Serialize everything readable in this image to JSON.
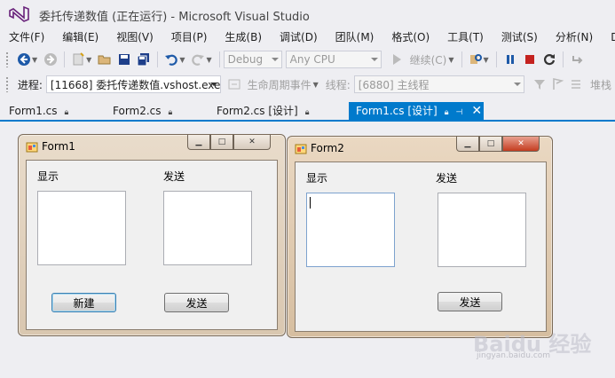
{
  "window": {
    "title": "委托传递数值 (正在运行) - Microsoft Visual Studio"
  },
  "menu": [
    "文件(F)",
    "编辑(E)",
    "视图(V)",
    "项目(P)",
    "生成(B)",
    "调试(D)",
    "团队(M)",
    "格式(O)",
    "工具(T)",
    "测试(S)",
    "分析(N)",
    "Dev"
  ],
  "toolbar": {
    "config": "Debug",
    "platform": "Any CPU",
    "continue_label": "继续(C)"
  },
  "debug_location": {
    "process_label": "进程:",
    "process_value": "[11668] 委托传递数值.vshost.exe",
    "lifecycle_label": "生命周期事件",
    "thread_label": "线程:",
    "thread_value": "[6880] 主线程",
    "stack_label": "堆栈"
  },
  "tabs": [
    {
      "label": "Form1.cs",
      "active": false
    },
    {
      "label": "Form2.cs",
      "active": false
    },
    {
      "label": "Form2.cs [设计]",
      "active": false
    },
    {
      "label": "Form1.cs [设计]",
      "active": true
    }
  ],
  "form1": {
    "title": "Form1",
    "label_display": "显示",
    "label_send": "发送",
    "btn_new": "新建",
    "btn_send": "发送"
  },
  "form2": {
    "title": "Form2",
    "label_display": "显示",
    "label_send": "发送",
    "btn_send": "发送"
  },
  "watermark": {
    "text": "Baidu 经验",
    "sub": "jingyan.baidu.com"
  },
  "colors": {
    "accent": "#007acc",
    "background": "#eeeef2"
  }
}
